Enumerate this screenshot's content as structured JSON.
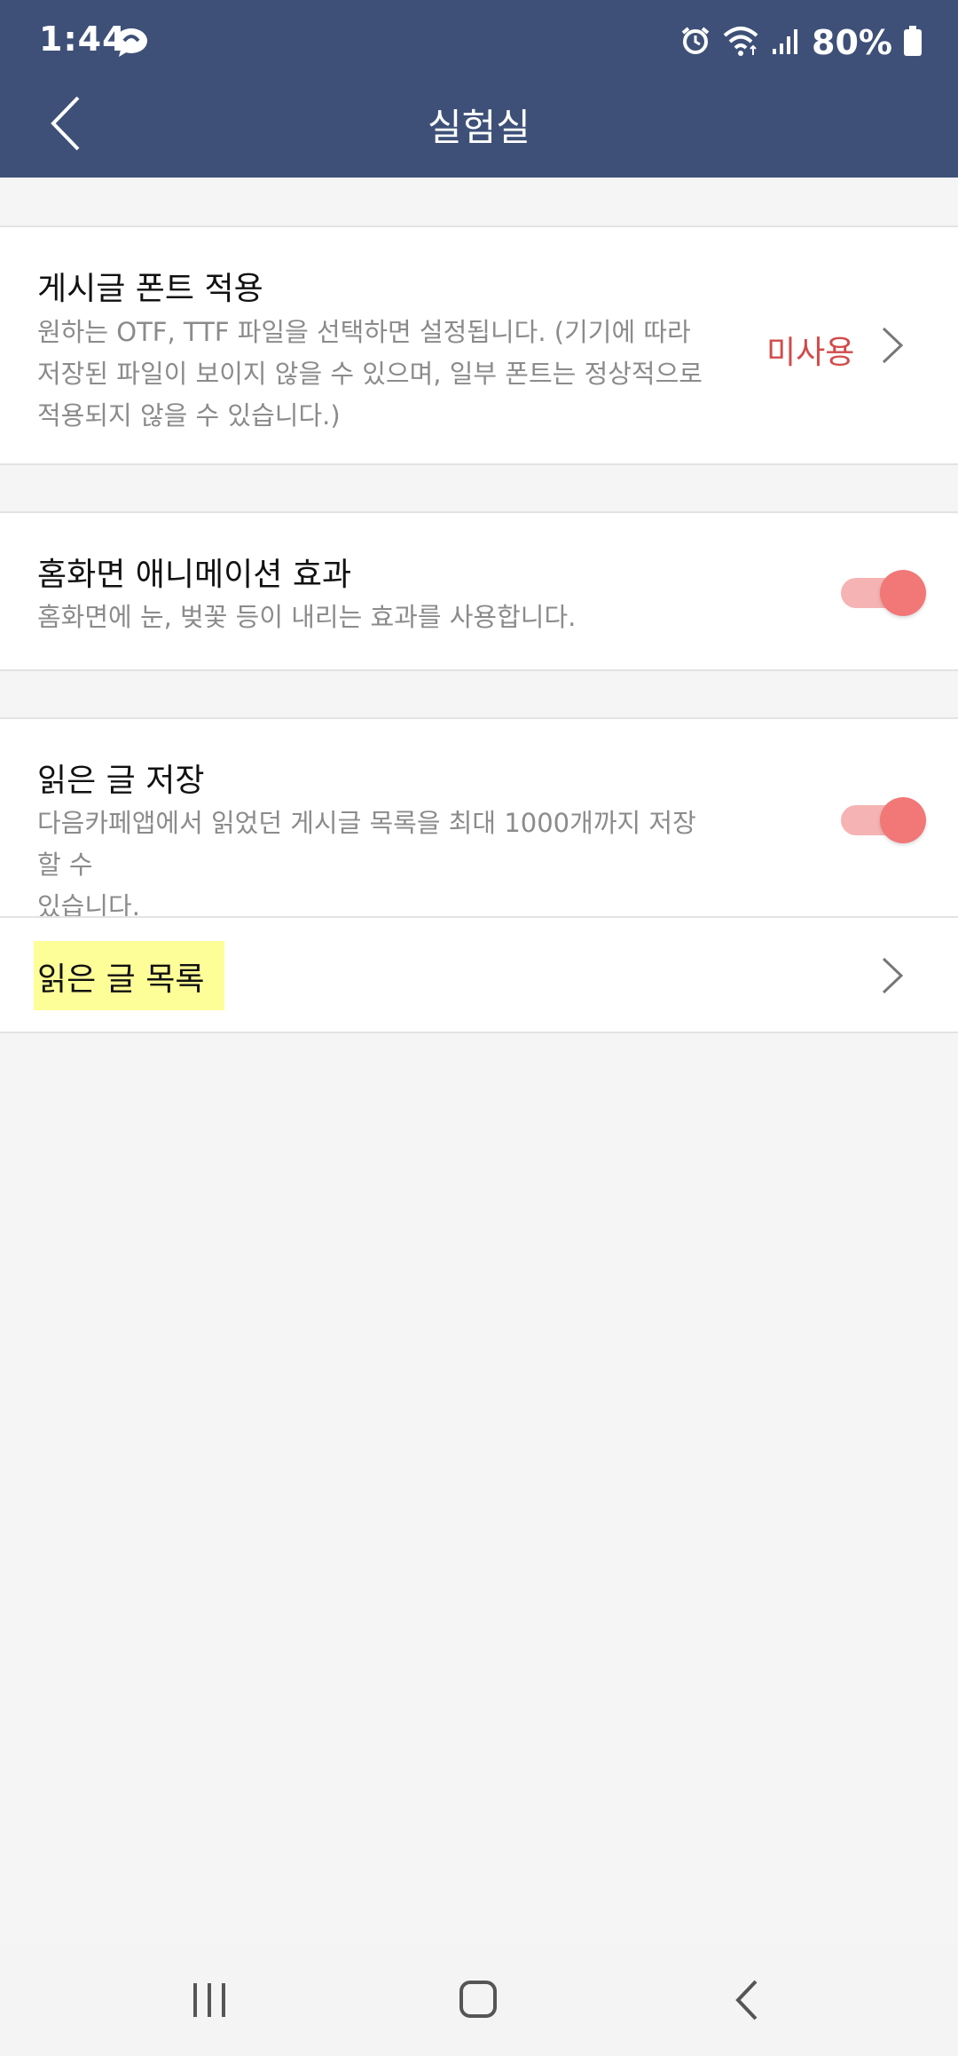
{
  "status_bar": {
    "time": "1:44",
    "battery": "80%",
    "icons": [
      "talk-icon",
      "alarm-icon",
      "wifi-icon",
      "signal-icon",
      "battery-icon"
    ]
  },
  "app_bar": {
    "title": "실험실",
    "back_icon": "chevron-left-icon"
  },
  "settings": {
    "font": {
      "title": "게시글 폰트 적용",
      "desc_lines": [
        "원하는 OTF, TTF 파일을 선택하면 설정됩니다. (기기에 따라",
        "저장된 파일이 보이지 않을 수 있으며, 일부 폰트는 정상적으로",
        "적용되지 않을 수 있습니다.)"
      ],
      "value": "미사용"
    },
    "home_animation": {
      "title": "홈화면 애니메이션 효과",
      "desc": "홈화면에 눈, 벚꽃 등이 내리는 효과를 사용합니다.",
      "enabled": true
    },
    "save_read": {
      "title": "읽은 글 저장",
      "desc_lines": [
        "다음카페앱에서 읽었던 게시글 목록을 최대 1000개까지 저장할 수",
        "있습니다."
      ],
      "enabled": true
    },
    "read_list": {
      "title": "읽은 글 목록"
    }
  },
  "colors": {
    "header_bg": "#3e5078",
    "accent_red": "#d24b4b",
    "toggle_knob": "#f27777",
    "toggle_track": "#f6b3b3",
    "highlight": "#fefe98"
  },
  "nav_bar": {
    "icons": [
      "recent-apps-icon",
      "home-icon",
      "back-icon"
    ]
  }
}
